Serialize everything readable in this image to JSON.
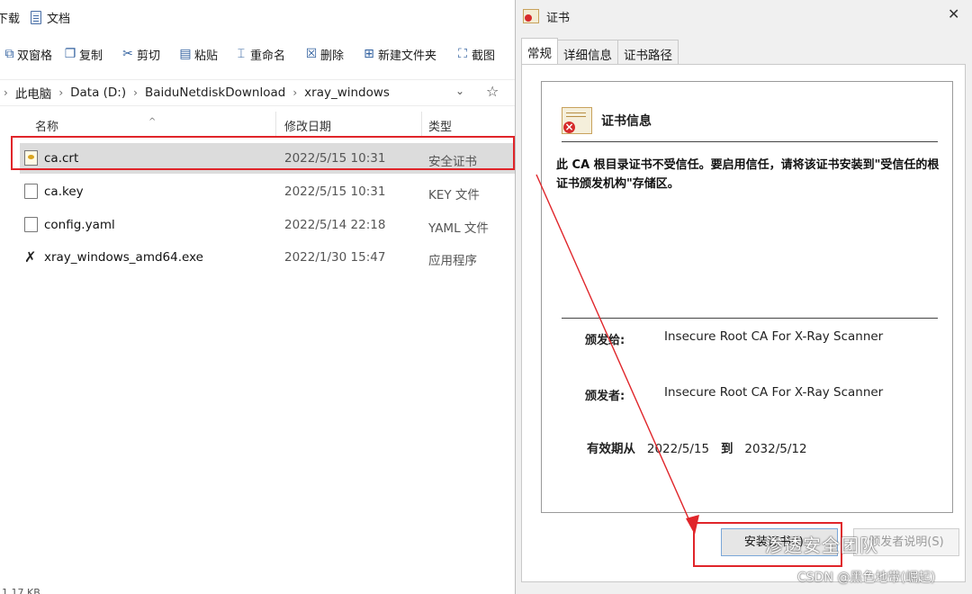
{
  "explorer": {
    "tab_prev_fragment": "下载",
    "tab_docs": "文档",
    "toolbar": [
      {
        "icon": "copy-window-icon",
        "glyph": "⧉",
        "label": "双窗格"
      },
      {
        "icon": "copy-icon",
        "glyph": "❐",
        "label": "复制"
      },
      {
        "icon": "scissors-icon",
        "glyph": "✂",
        "label": "剪切"
      },
      {
        "icon": "paste-icon",
        "glyph": "▤",
        "label": "粘贴"
      },
      {
        "icon": "rename-icon",
        "glyph": "⌶",
        "label": "重命名"
      },
      {
        "icon": "delete-icon",
        "glyph": "☒",
        "label": "删除"
      },
      {
        "icon": "new-folder-icon",
        "glyph": "⊞",
        "label": "新建文件夹"
      },
      {
        "icon": "screenshot-icon",
        "glyph": "⛶",
        "label": "截图"
      }
    ],
    "breadcrumb": [
      "此电脑",
      "Data (D:)",
      "BaiduNetdiskDownload",
      "xray_windows"
    ],
    "columns": {
      "name": "名称",
      "modified": "修改日期",
      "type": "类型"
    },
    "files": [
      {
        "name": "ca.crt",
        "date": "2022/5/15 10:31",
        "type": "安全证书",
        "icon": "certificate-file-icon",
        "selected": true
      },
      {
        "name": "ca.key",
        "date": "2022/5/15 10:31",
        "type": "KEY 文件",
        "icon": "file-icon",
        "selected": false
      },
      {
        "name": "config.yaml",
        "date": "2022/5/14 22:18",
        "type": "YAML 文件",
        "icon": "file-icon",
        "selected": false
      },
      {
        "name": "xray_windows_amd64.exe",
        "date": "2022/1/30 15:47",
        "type": "应用程序",
        "icon": "executable-icon",
        "selected": false
      }
    ],
    "status_fragment": "1.17 KB"
  },
  "dialog": {
    "title": "证书",
    "tabs": [
      "常规",
      "详细信息",
      "证书路径"
    ],
    "info_title": "证书信息",
    "warning": "此 CA 根目录证书不受信任。要启用信任，请将该证书安装到\"受信任的根证书颁发机构\"存储区。",
    "issued_to_label": "颁发给:",
    "issued_to_value": "Insecure Root CA For X-Ray Scanner",
    "issued_by_label": "颁发者:",
    "issued_by_value": "Insecure Root CA For X-Ray Scanner",
    "valid_from_label": "有效期从",
    "valid_from": "2022/5/15",
    "valid_to_label": "到",
    "valid_to": "2032/5/12",
    "install_button": "安装证书(I)...",
    "issuer_statement_button": "颁发者说明(S)"
  },
  "overlay": {
    "watermark": "渗透安全团队",
    "credit": "CSDN @黑色地带(崛起)",
    "annotation_color": "#e0252a"
  }
}
